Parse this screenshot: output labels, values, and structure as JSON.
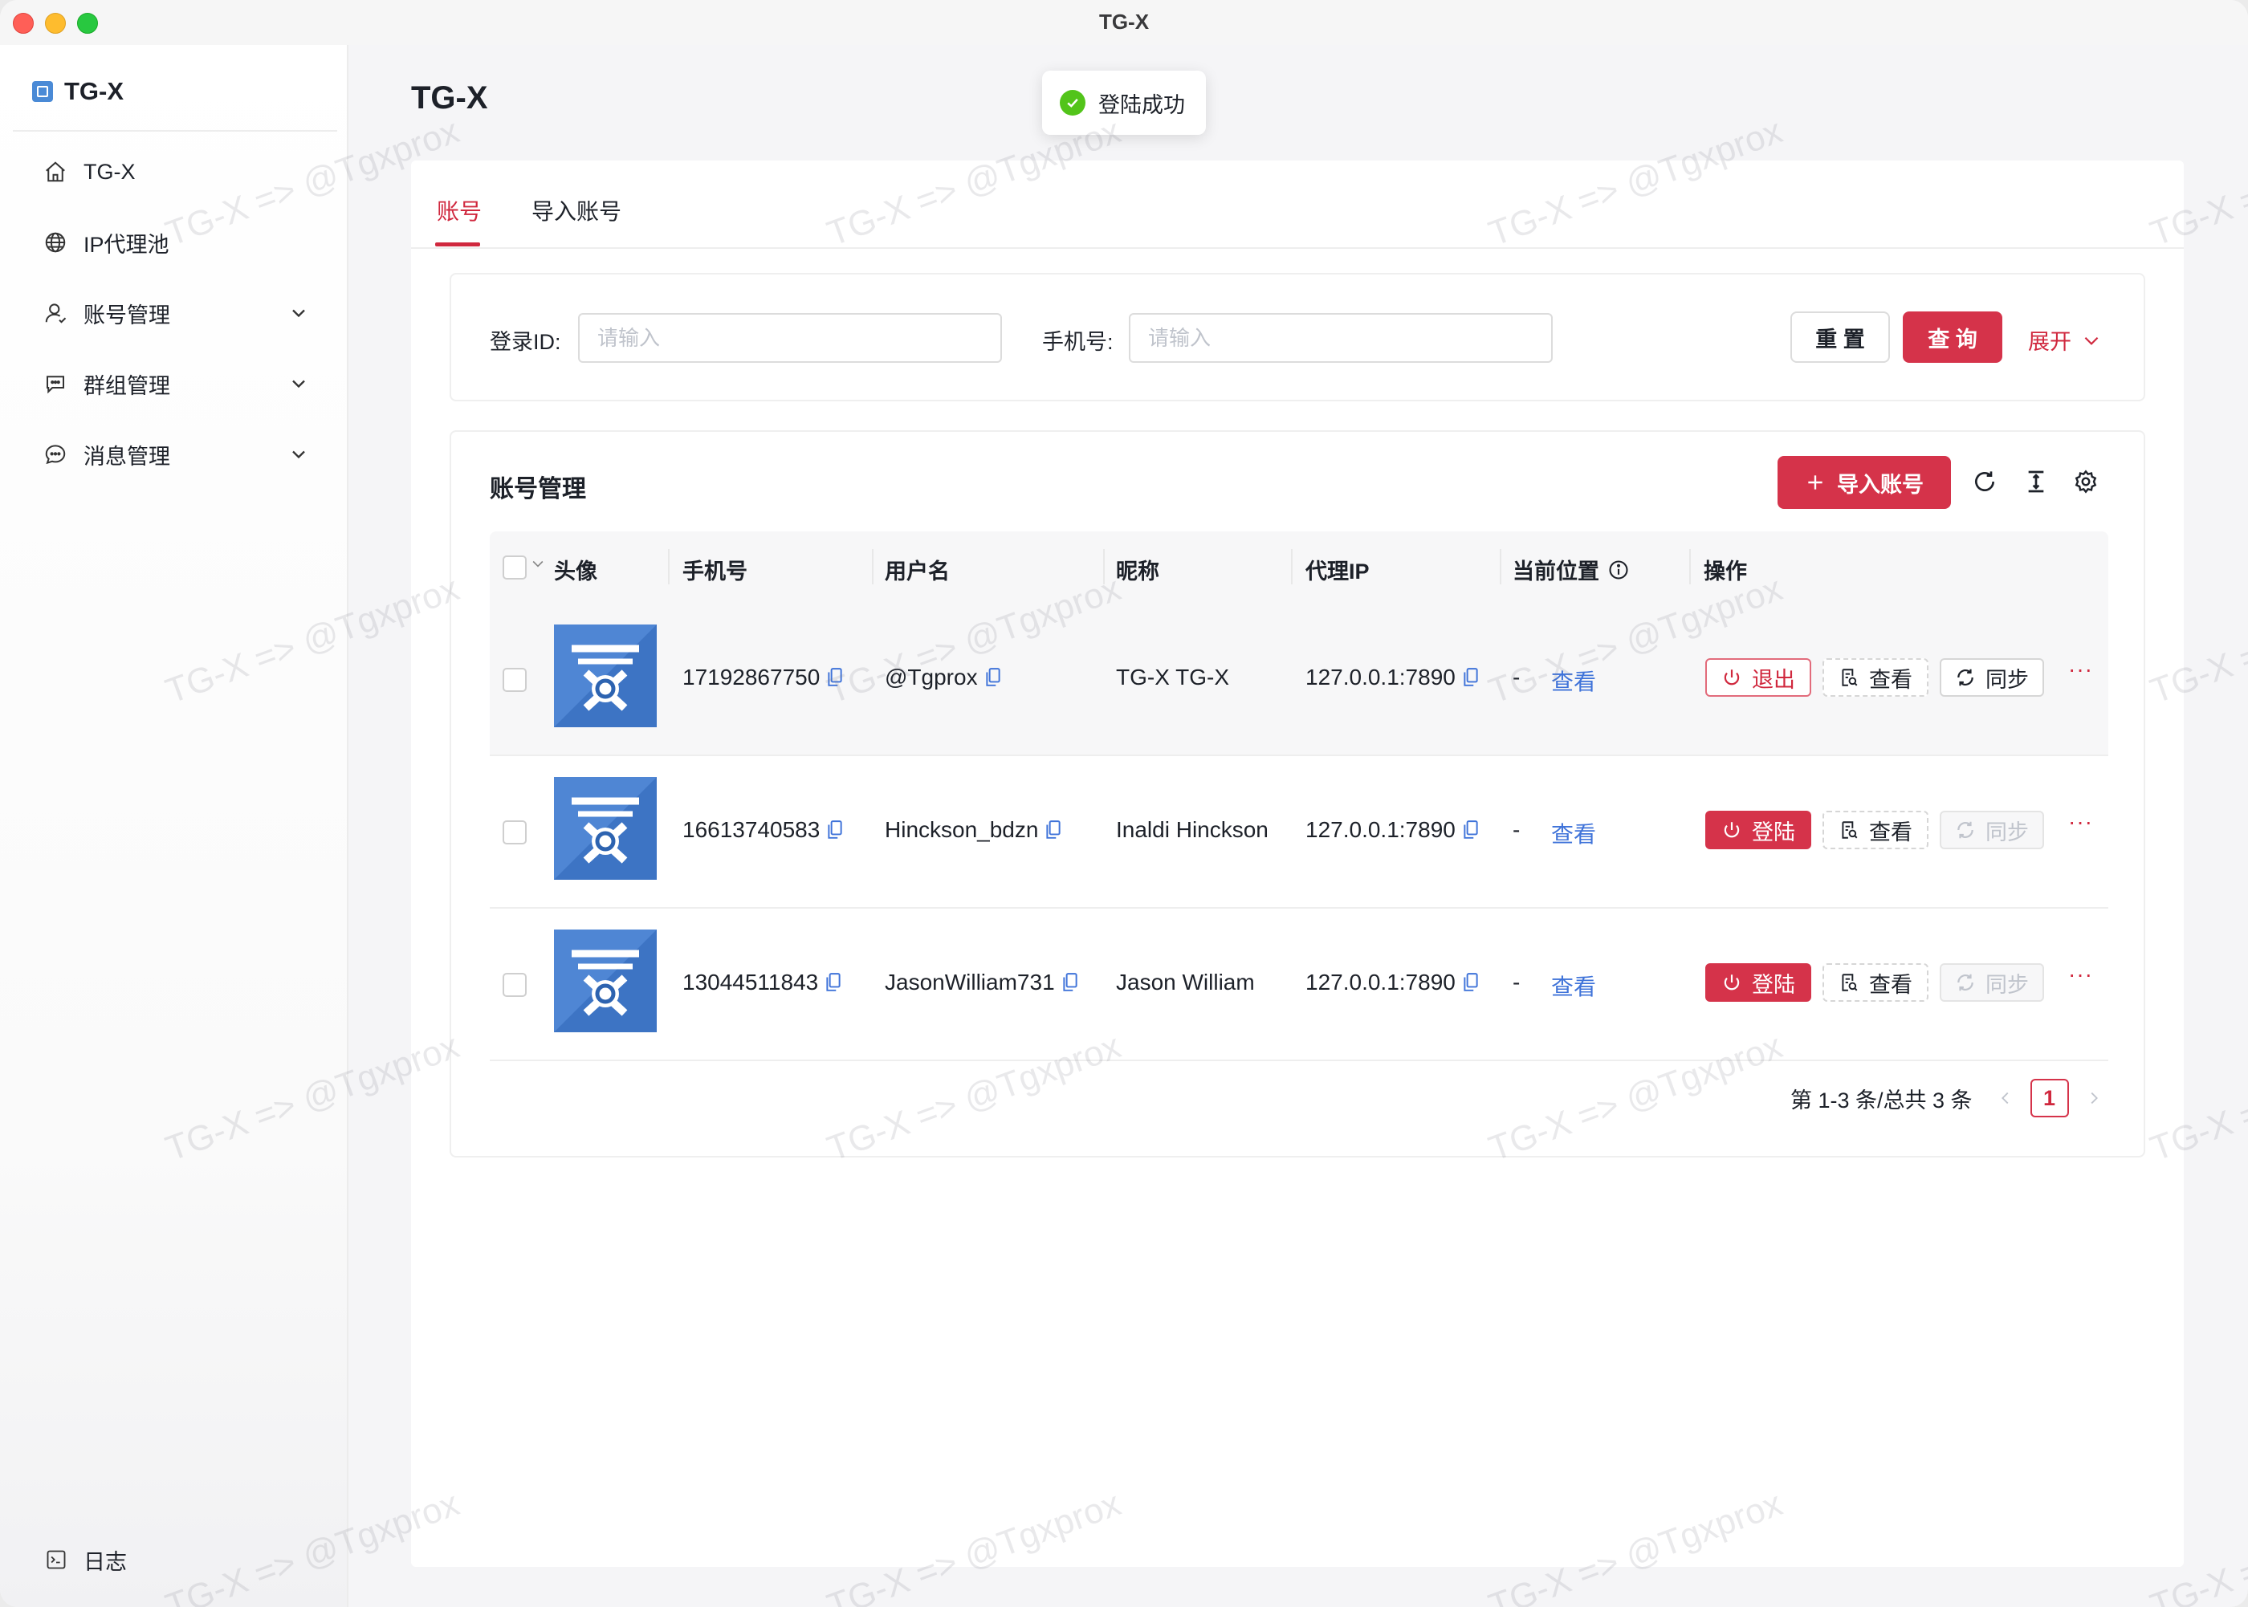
{
  "window": {
    "title": "TG-X"
  },
  "sidebar": {
    "logo_text": "TG-X",
    "items": [
      {
        "label": "TG-X",
        "icon": "home-icon"
      },
      {
        "label": "IP代理池",
        "icon": "globe-icon"
      },
      {
        "label": "账号管理",
        "icon": "user-icon",
        "has_children": true
      },
      {
        "label": "群组管理",
        "icon": "group-chat-icon",
        "has_children": true
      },
      {
        "label": "消息管理",
        "icon": "message-icon",
        "has_children": true
      }
    ],
    "log_label": "日志"
  },
  "page": {
    "title": "TG-X"
  },
  "toast": {
    "text": "登陆成功"
  },
  "tabs": [
    {
      "label": "账号",
      "active": true
    },
    {
      "label": "导入账号",
      "active": false
    }
  ],
  "search": {
    "login_id_label": "登录ID:",
    "login_id_placeholder": "请输入",
    "phone_label": "手机号:",
    "phone_placeholder": "请输入",
    "reset_label": "重 置",
    "query_label": "查 询",
    "expand_label": "展开"
  },
  "table_panel": {
    "title": "账号管理",
    "import_label": "导入账号",
    "columns": [
      "头像",
      "手机号",
      "用户名",
      "昵称",
      "代理IP",
      "当前位置",
      "操作"
    ],
    "rows": [
      {
        "phone": "17192867750",
        "username": "@Tgprox",
        "nickname": "TG-X TG-X",
        "proxy": "127.0.0.1:7890",
        "location": "-",
        "location_link": "查看",
        "primary_action": "退出",
        "view_label": "查看",
        "sync_label": "同步",
        "sync_enabled": true,
        "more": "···"
      },
      {
        "phone": "16613740583",
        "username": "Hinckson_bdzn",
        "nickname": "Inaldi Hinckson",
        "proxy": "127.0.0.1:7890",
        "location": "-",
        "location_link": "查看",
        "primary_action": "登陆",
        "view_label": "查看",
        "sync_label": "同步",
        "sync_enabled": false,
        "more": "···"
      },
      {
        "phone": "13044511843",
        "username": "JasonWilliam731",
        "nickname": "Jason William",
        "proxy": "127.0.0.1:7890",
        "location": "-",
        "location_link": "查看",
        "primary_action": "登陆",
        "view_label": "查看",
        "sync_label": "同步",
        "sync_enabled": false,
        "more": "···"
      }
    ],
    "pagination": {
      "summary": "第 1-3 条/总共 3 条",
      "current_page": "1"
    }
  },
  "watermark": "TG-X => @Tgxprox",
  "colors": {
    "primary": "#d5334a",
    "link": "#3f73d9",
    "success": "#52c41a",
    "avatar_bg": "#4f86d4"
  }
}
